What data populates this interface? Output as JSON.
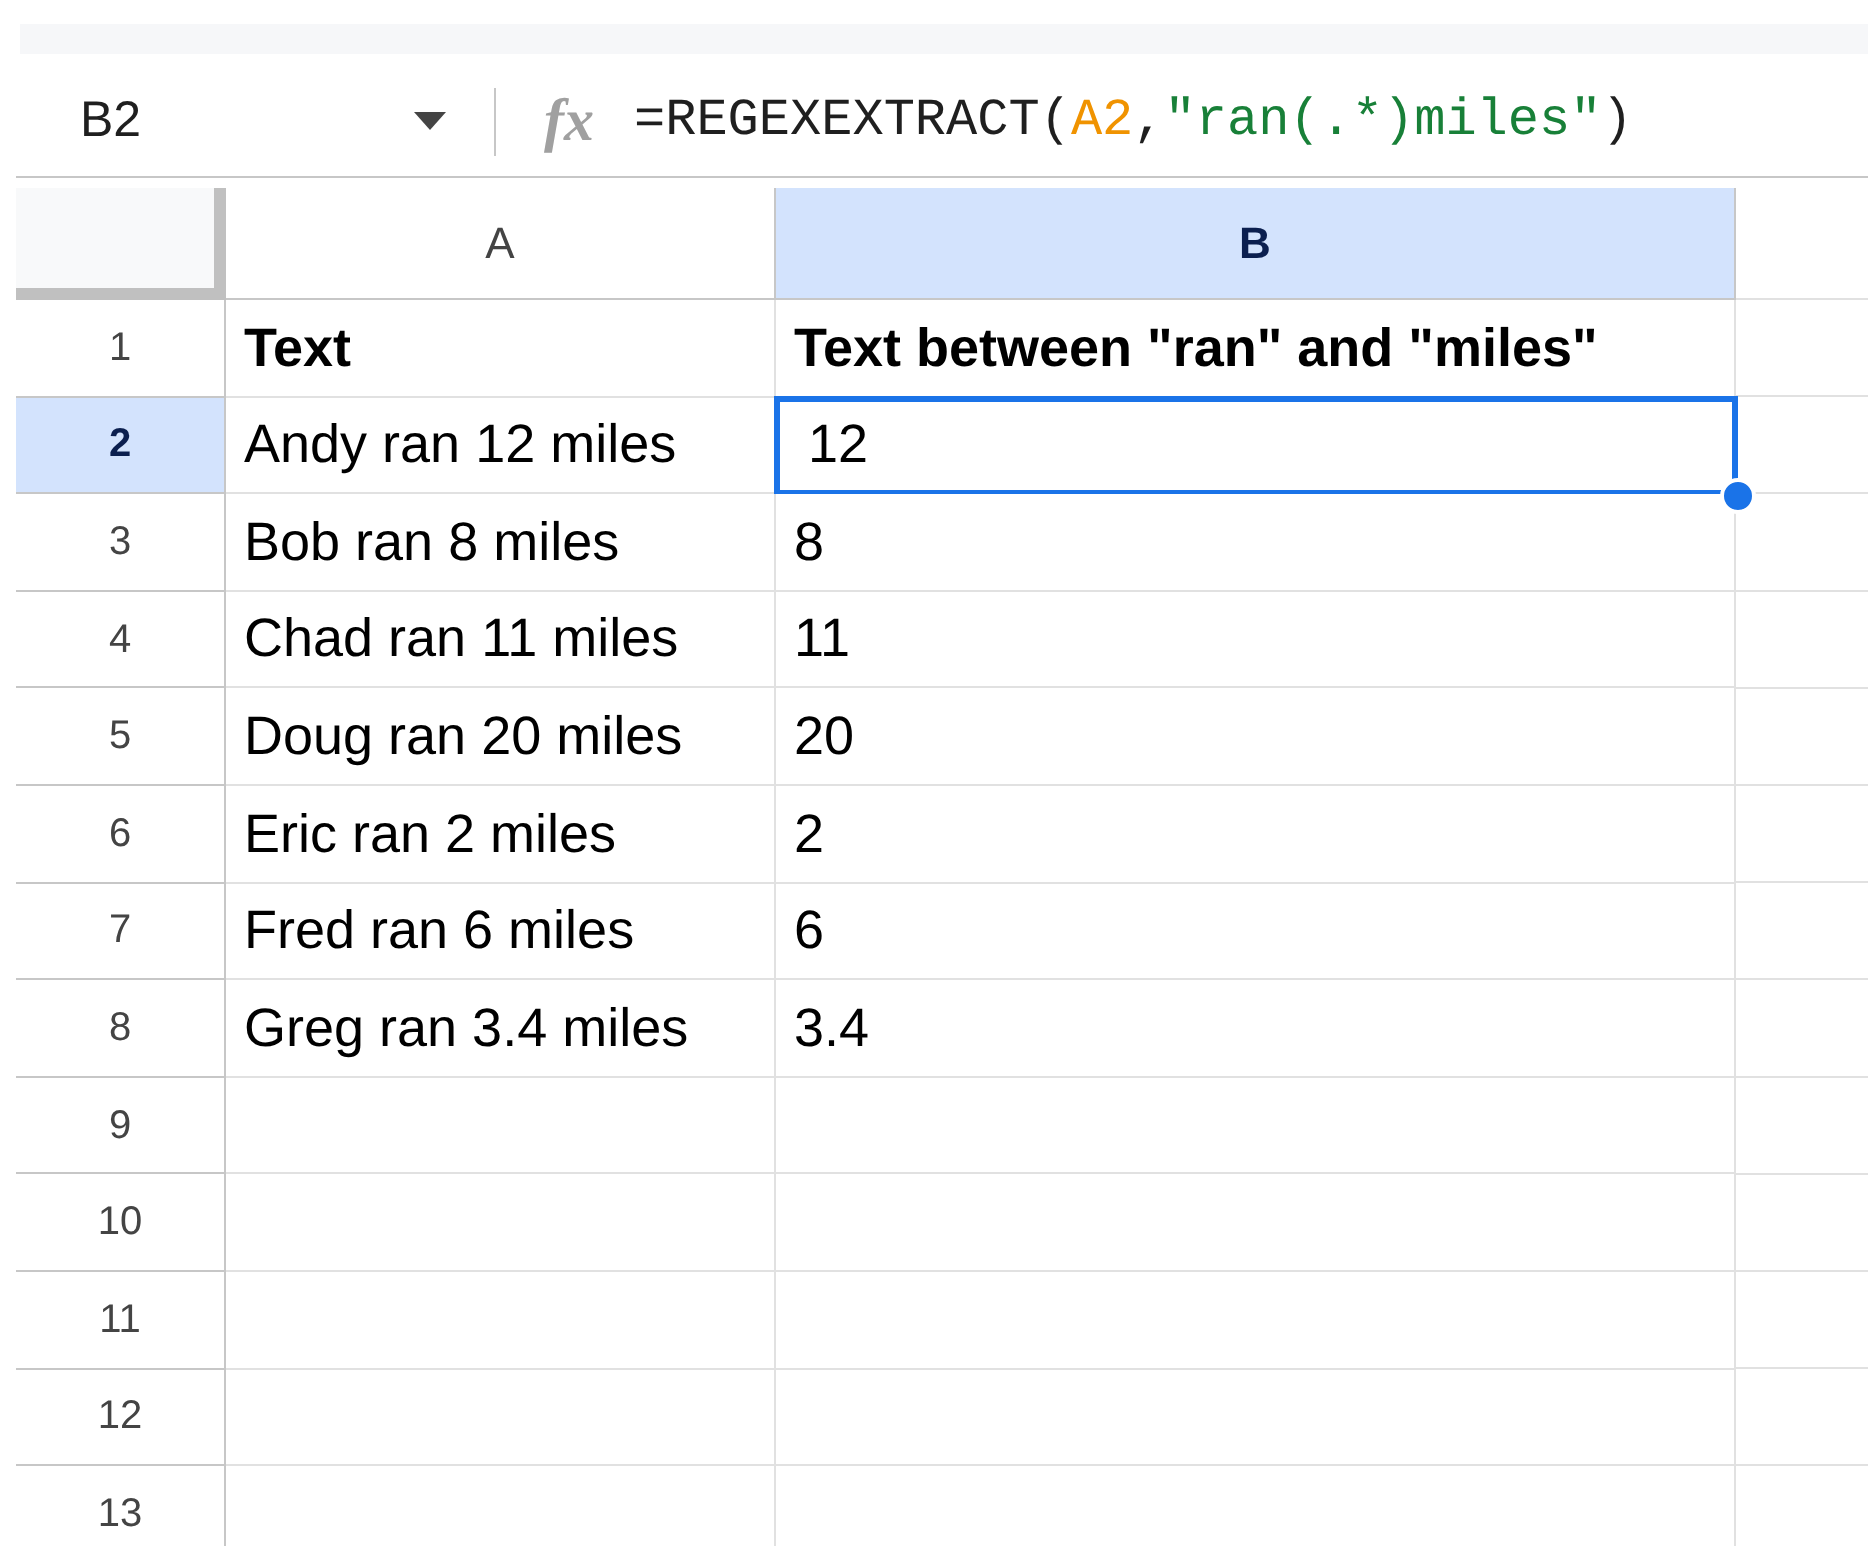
{
  "formula_bar": {
    "cell_reference": "B2",
    "function_label": "fx",
    "formula": [
      {
        "kind": "text",
        "text": "=REGEXEXTRACT("
      },
      {
        "kind": "ref",
        "text": "A2"
      },
      {
        "kind": "text",
        "text": ","
      },
      {
        "kind": "string",
        "text": "\"ran(.*)miles\""
      },
      {
        "kind": "text",
        "text": ")"
      }
    ]
  },
  "columns": [
    {
      "label": "A",
      "selected": false
    },
    {
      "label": "B",
      "selected": true
    }
  ],
  "rows": [
    {
      "number": "1",
      "selected": false,
      "bold": true,
      "cells": [
        {
          "text": "Text",
          "active": false
        },
        {
          "text": "Text between \"ran\" and \"miles\"",
          "active": false
        }
      ]
    },
    {
      "number": "2",
      "selected": true,
      "bold": false,
      "cells": [
        {
          "text": "Andy ran 12 miles",
          "active": false
        },
        {
          "text": "12",
          "active": true
        }
      ]
    },
    {
      "number": "3",
      "selected": false,
      "bold": false,
      "cells": [
        {
          "text": "Bob ran 8 miles",
          "active": false
        },
        {
          "text": "8",
          "active": false
        }
      ]
    },
    {
      "number": "4",
      "selected": false,
      "bold": false,
      "cells": [
        {
          "text": "Chad ran 11 miles",
          "active": false
        },
        {
          "text": "11",
          "active": false
        }
      ]
    },
    {
      "number": "5",
      "selected": false,
      "bold": false,
      "cells": [
        {
          "text": "Doug ran 20 miles",
          "active": false
        },
        {
          "text": "20",
          "active": false
        }
      ]
    },
    {
      "number": "6",
      "selected": false,
      "bold": false,
      "cells": [
        {
          "text": "Eric ran 2 miles",
          "active": false
        },
        {
          "text": "2",
          "active": false
        }
      ]
    },
    {
      "number": "7",
      "selected": false,
      "bold": false,
      "cells": [
        {
          "text": "Fred ran 6 miles",
          "active": false
        },
        {
          "text": "6",
          "active": false
        }
      ]
    },
    {
      "number": "8",
      "selected": false,
      "bold": false,
      "cells": [
        {
          "text": "Greg ran 3.4 miles",
          "active": false
        },
        {
          "text": "3.4",
          "active": false
        }
      ]
    },
    {
      "number": "9",
      "selected": false
    },
    {
      "number": "10",
      "selected": false
    },
    {
      "number": "11",
      "selected": false
    },
    {
      "number": "12",
      "selected": false
    },
    {
      "number": "13",
      "selected": false
    }
  ]
}
